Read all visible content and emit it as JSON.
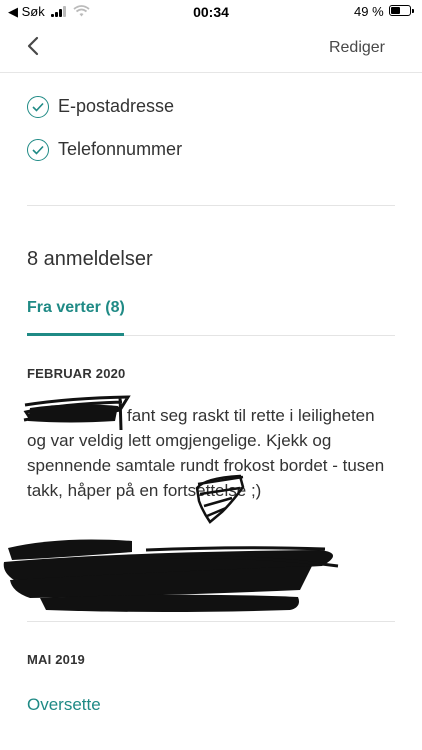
{
  "status_bar": {
    "back_app": "◀ Søk",
    "time": "00:34",
    "battery_percent": "49 %",
    "battery_level": 0.49
  },
  "nav": {
    "edit_label": "Rediger"
  },
  "verifications": [
    {
      "label": "E-postadresse"
    },
    {
      "label": "Telefonnummer"
    }
  ],
  "reviews": {
    "title": "8 anmeldelser",
    "tab_label": "Fra verter (8)",
    "items": [
      {
        "date": "FEBRUAR 2020",
        "text": "fant seg raskt til rette i leiligheten og var veldig lett omgjengelige. Kjekk og spennende samtale rundt frokost bordet - tusen takk, håper på en fortsettelse ;)"
      },
      {
        "date": "MAI 2019",
        "translate_label": "Oversette"
      }
    ]
  },
  "colors": {
    "accent": "#1f8a85",
    "text": "#333333",
    "divider": "#e4e4e4"
  }
}
